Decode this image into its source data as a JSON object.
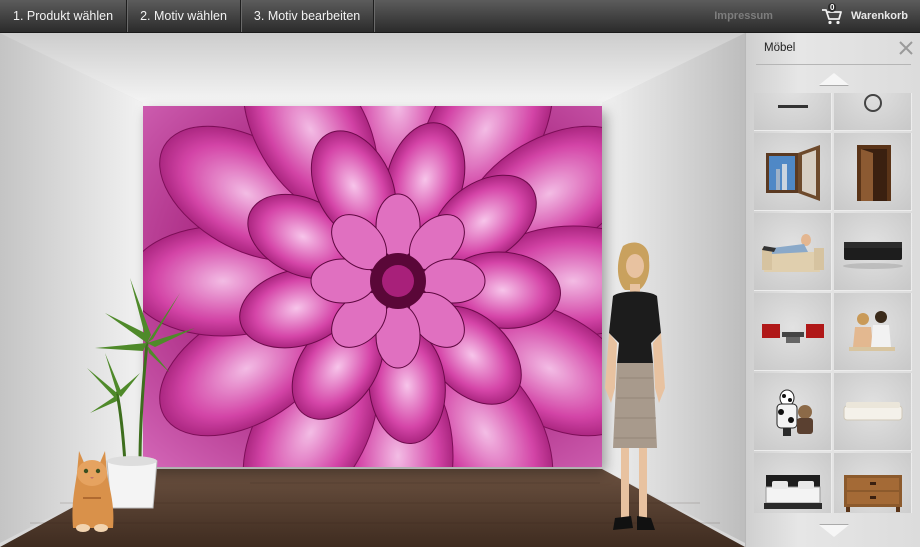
{
  "nav": {
    "steps": [
      "1. Produkt wählen",
      "2. Motiv wählen",
      "3. Motiv bearbeiten"
    ],
    "impressum": "Impressum",
    "cart_label": "Warenkorb",
    "cart_count": "0"
  },
  "panel": {
    "title": "Möbel",
    "items": [
      {
        "icon": "partial-item-icon"
      },
      {
        "icon": "partial-clock-icon"
      },
      {
        "icon": "window-icon"
      },
      {
        "icon": "door-icon"
      },
      {
        "icon": "person-on-sofa-icon"
      },
      {
        "icon": "black-sofa-icon"
      },
      {
        "icon": "red-chairs-table-icon"
      },
      {
        "icon": "couple-sitting-icon"
      },
      {
        "icon": "dogs-icon"
      },
      {
        "icon": "white-sofa-icon"
      },
      {
        "icon": "bed-icon"
      },
      {
        "icon": "wooden-dresser-icon"
      }
    ]
  },
  "colors": {
    "flower_main": "#c2238f",
    "flower_light": "#e98fd0",
    "floor": "#5a4232"
  }
}
